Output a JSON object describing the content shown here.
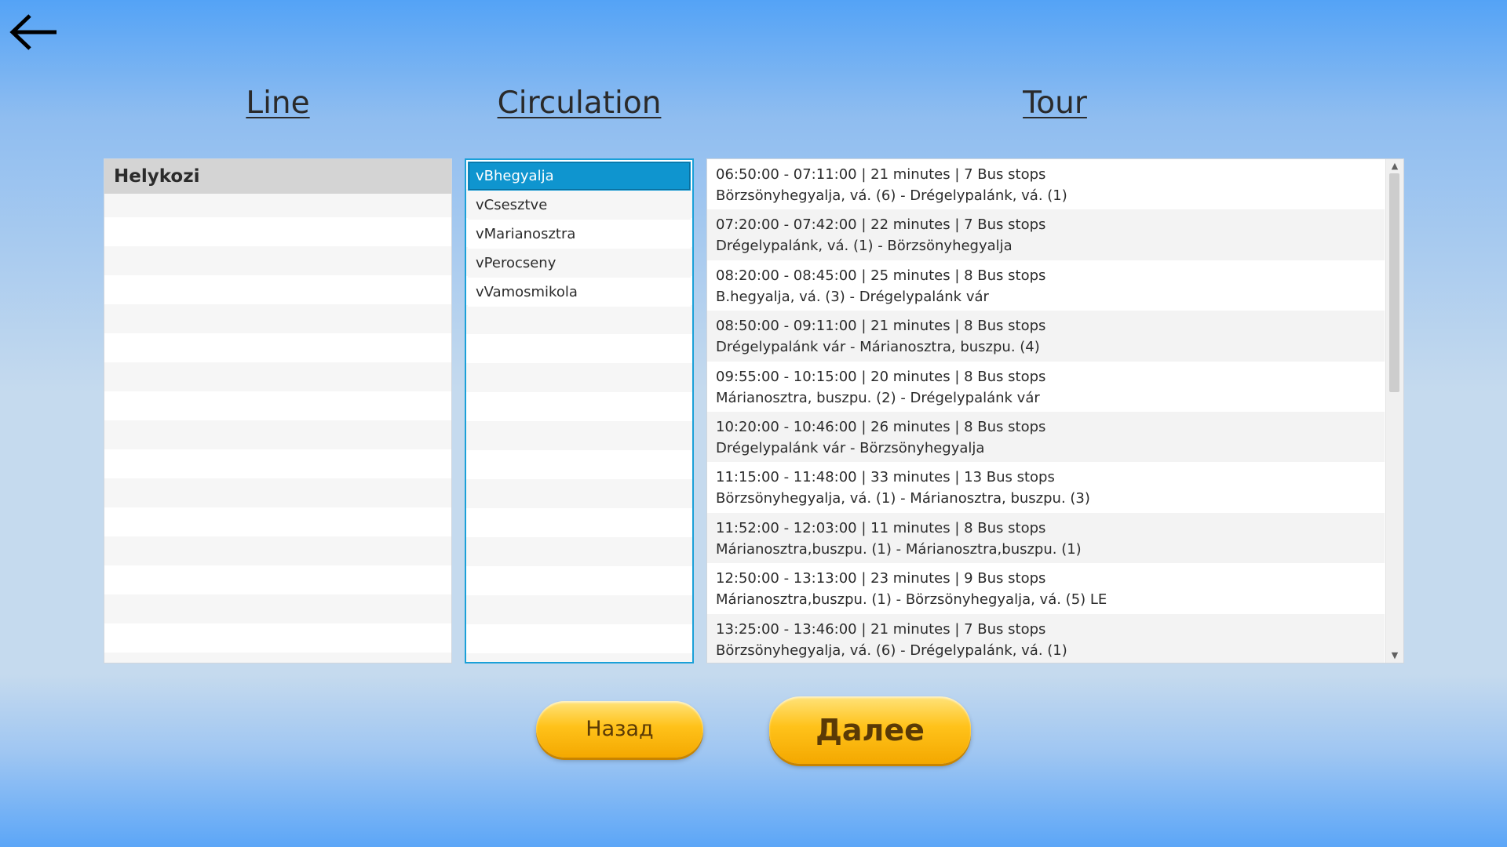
{
  "nav": {
    "back_icon": "arrow-left-icon"
  },
  "columns": {
    "line_title": "Line",
    "circulation_title": "Circulation",
    "tour_title": "Tour"
  },
  "line": {
    "selected": "Helykozi"
  },
  "circulation": {
    "items": [
      "vBhegyalja",
      "vCsesztve",
      "vMarianosztra",
      "vPerocseny",
      "vVamosmikola"
    ],
    "selected_index": 0
  },
  "tour": {
    "items": [
      {
        "times": "06:50:00 - 07:11:00 | 21 minutes | 7 Bus stops",
        "route": "Börzsönyhegyalja, vá. (6) - Drégelypalánk, vá. (1)"
      },
      {
        "times": "07:20:00 - 07:42:00 | 22 minutes | 7 Bus stops",
        "route": "Drégelypalánk, vá. (1) - Börzsönyhegyalja"
      },
      {
        "times": "08:20:00 - 08:45:00 | 25 minutes | 8 Bus stops",
        "route": "B.hegyalja, vá. (3) - Drégelypalánk vár"
      },
      {
        "times": "08:50:00 - 09:11:00 | 21 minutes | 8 Bus stops",
        "route": "Drégelypalánk vár - Márianosztra, buszpu. (4)"
      },
      {
        "times": "09:55:00 - 10:15:00 | 20 minutes | 8 Bus stops",
        "route": "Márianosztra, buszpu. (2) - Drégelypalánk vár"
      },
      {
        "times": "10:20:00 - 10:46:00 | 26 minutes | 8 Bus stops",
        "route": "Drégelypalánk vár - Börzsönyhegyalja"
      },
      {
        "times": "11:15:00 - 11:48:00 | 33 minutes | 13 Bus stops",
        "route": "Börzsönyhegyalja, vá. (1) - Márianosztra, buszpu. (3)"
      },
      {
        "times": "11:52:00 - 12:03:00 | 11 minutes | 8 Bus stops",
        "route": "Márianosztra,buszpu. (1) - Márianosztra,buszpu. (1)"
      },
      {
        "times": "12:50:00 - 13:13:00 | 23 minutes | 9 Bus stops",
        "route": "Márianosztra,buszpu. (1) - Börzsönyhegyalja, vá. (5) LE"
      },
      {
        "times": "13:25:00 - 13:46:00 | 21 minutes | 7 Bus stops",
        "route": "Börzsönyhegyalja, vá. (6) - Drégelypalánk, vá. (1)"
      }
    ],
    "scroll": {
      "position_fraction": 0.0,
      "visible_fraction": 0.46
    }
  },
  "buttons": {
    "back_label": "Назад",
    "next_label": "Далее"
  },
  "colors": {
    "selection": "#0f95cf",
    "button_yellow": "#ffc21a",
    "button_text": "#5a3a06"
  }
}
